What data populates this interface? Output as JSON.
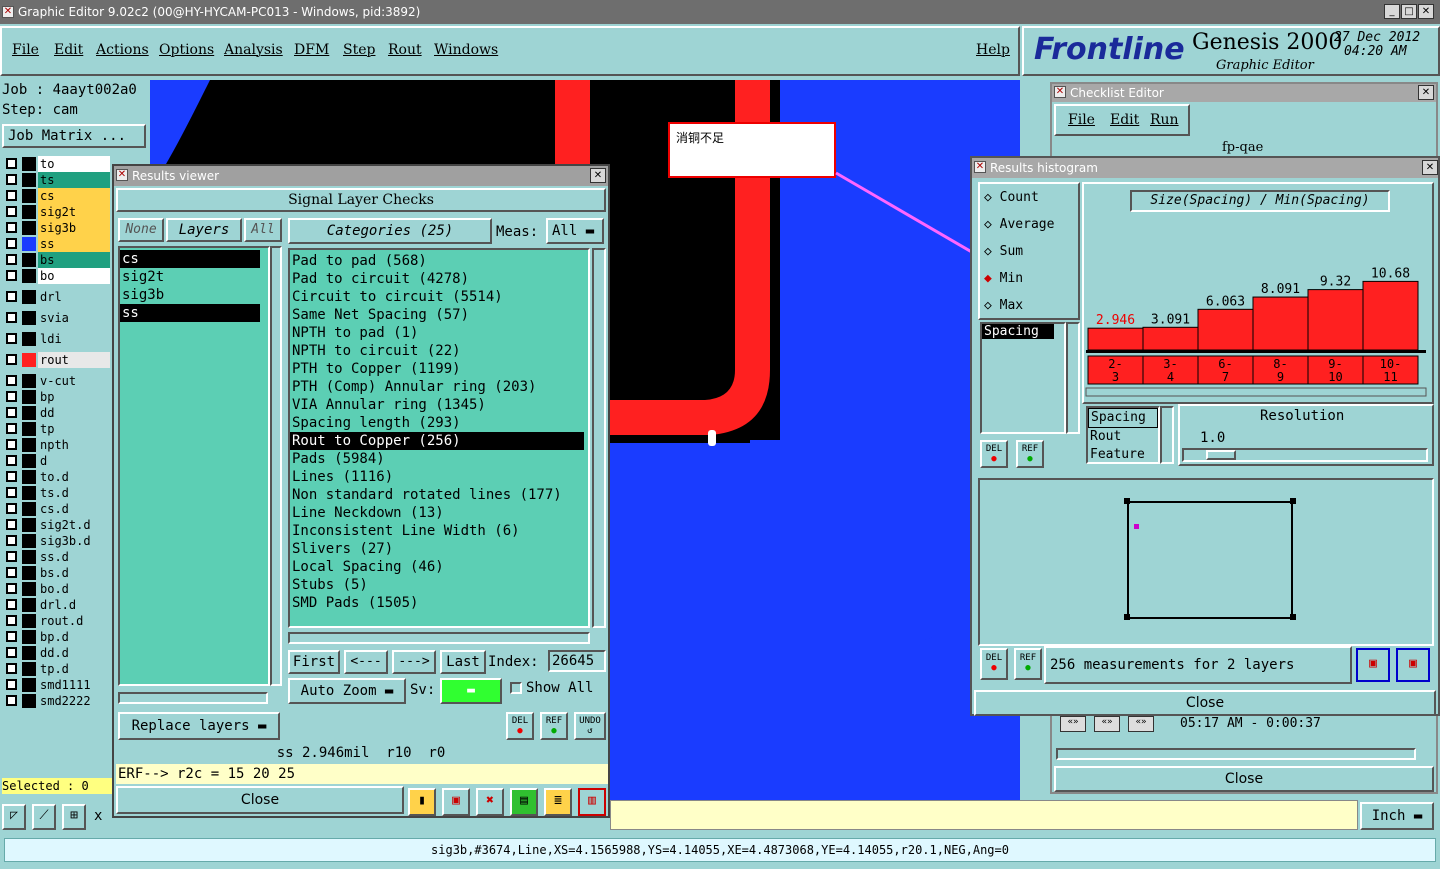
{
  "main_window": {
    "title": "Graphic Editor 9.02c2 (00@HY-HYCAM-PC013 - Windows, pid:3892)",
    "menu": [
      "File",
      "Edit",
      "Actions",
      "Options",
      "Analysis",
      "DFM",
      "Step",
      "Rout",
      "Windows"
    ],
    "help": "Help",
    "brand": "Frontline",
    "product": "Genesis 2000",
    "subtitle": "Graphic Editor",
    "date": "27 Dec 2012",
    "time": "04:20 AM"
  },
  "job_panel": {
    "job": "Job : 4aayt002a0",
    "step": "Step: cam",
    "job_matrix_button": "Job Matrix ...",
    "selected": "Selected : 0",
    "layers": [
      {
        "name": "to",
        "color": "#ffffff",
        "swatch": "#000000"
      },
      {
        "name": "ts",
        "color": "#20a080",
        "swatch": "#000000"
      },
      {
        "name": "cs",
        "color": "#ffd24a",
        "swatch": "#000000"
      },
      {
        "name": "sig2t",
        "color": "#ffd24a",
        "swatch": "#000000"
      },
      {
        "name": "sig3b",
        "color": "#ffd24a",
        "swatch": "#000000"
      },
      {
        "name": "ss",
        "color": "#ffd24a",
        "swatch": "#1a3cff"
      },
      {
        "name": "bs",
        "color": "#20a080",
        "swatch": "#000000"
      },
      {
        "name": "bo",
        "color": "#ffffff",
        "swatch": "#000000"
      },
      {
        "name": "drl",
        "color": "#9ed4d4",
        "swatch": "#000000"
      },
      {
        "name": "svia",
        "color": "#9ed4d4",
        "swatch": "#000000"
      },
      {
        "name": "ldi",
        "color": "#9ed4d4",
        "swatch": "#000000"
      },
      {
        "name": "rout",
        "color": "#e8e8e8",
        "swatch": "#ff2020"
      },
      {
        "name": "v-cut",
        "color": "#9ed4d4",
        "swatch": "#000000"
      },
      {
        "name": "bp",
        "color": "#9ed4d4",
        "swatch": "#000000"
      },
      {
        "name": "dd",
        "color": "#9ed4d4",
        "swatch": "#000000"
      },
      {
        "name": "tp",
        "color": "#9ed4d4",
        "swatch": "#000000"
      },
      {
        "name": "npth",
        "color": "#9ed4d4",
        "swatch": "#000000"
      },
      {
        "name": "d",
        "color": "#9ed4d4",
        "swatch": "#000000"
      },
      {
        "name": "to.d",
        "color": "#9ed4d4",
        "swatch": "#000000"
      },
      {
        "name": "ts.d",
        "color": "#9ed4d4",
        "swatch": "#000000"
      },
      {
        "name": "cs.d",
        "color": "#9ed4d4",
        "swatch": "#000000"
      },
      {
        "name": "sig2t.d",
        "color": "#9ed4d4",
        "swatch": "#000000"
      },
      {
        "name": "sig3b.d",
        "color": "#9ed4d4",
        "swatch": "#000000"
      },
      {
        "name": "ss.d",
        "color": "#9ed4d4",
        "swatch": "#000000"
      },
      {
        "name": "bs.d",
        "color": "#9ed4d4",
        "swatch": "#000000"
      },
      {
        "name": "bo.d",
        "color": "#9ed4d4",
        "swatch": "#000000"
      },
      {
        "name": "drl.d",
        "color": "#9ed4d4",
        "swatch": "#000000"
      },
      {
        "name": "rout.d",
        "color": "#9ed4d4",
        "swatch": "#000000"
      },
      {
        "name": "bp.d",
        "color": "#9ed4d4",
        "swatch": "#000000"
      },
      {
        "name": "dd.d",
        "color": "#9ed4d4",
        "swatch": "#000000"
      },
      {
        "name": "tp.d",
        "color": "#9ed4d4",
        "swatch": "#000000"
      },
      {
        "name": "smd1111",
        "color": "#9ed4d4",
        "swatch": "#000000"
      },
      {
        "name": "smd2222",
        "color": "#9ed4d4",
        "swatch": "#000000"
      }
    ]
  },
  "annotation": {
    "text": "消铜不足"
  },
  "results_viewer": {
    "title": "Results viewer",
    "header": "Signal Layer Checks",
    "none_btn": "None",
    "layers_label": "Layers",
    "all_btn": "All",
    "layers": [
      "cs",
      "sig2t",
      "sig3b",
      "ss"
    ],
    "categories_label": "Categories (25)",
    "meas_label": "Meas:",
    "meas_value": "All",
    "categories": [
      "Pad to pad (568)",
      "Pad to circuit (4278)",
      "Circuit to circuit (5514)",
      "Same Net Spacing (57)",
      "NPTH to pad (1)",
      "NPTH to circuit (22)",
      "PTH to Copper (1199)",
      "PTH (Comp) Annular ring (203)",
      "VIA Annular ring (1345)",
      "Spacing length (293)",
      "Rout to Copper (256)",
      "Pads (5984)",
      "Lines (1116)",
      "Non standard rotated lines (177)",
      "Line Neckdown (13)",
      "Inconsistent Line Width (6)",
      "Slivers (27)",
      "Local Spacing (46)",
      "Stubs (5)",
      "SMD Pads (1505)"
    ],
    "first_btn": "First",
    "prev_btn": "<---",
    "next_btn": "--->",
    "last_btn": "Last",
    "index_label": "Index:",
    "index_value": "26645",
    "auto_zoom": "Auto Zoom",
    "sv_label": "Sv:",
    "show_all": "Show All",
    "replace_layers": "Replace layers",
    "del": "DEL",
    "ref": "REF",
    "undo": "UNDO",
    "status": "ss 2.946mil  r10  r0",
    "erf": "ERF--> r2c = 15 20 25",
    "close": "Close"
  },
  "checklist_editor": {
    "title": "Checklist Editor",
    "menu": [
      "File",
      "Edit",
      "Run"
    ],
    "name": "fp-qae",
    "time_row": "05:17 AM - 0:00:37",
    "close": "Close"
  },
  "histogram": {
    "title": "Results histogram",
    "options": [
      "Count",
      "Average",
      "Sum",
      "Min",
      "Max"
    ],
    "selected_option": "Min",
    "chart_title": "Size(Spacing) / Min(Spacing)",
    "field_list": [
      "Spacing"
    ],
    "sort_list": [
      "Spacing",
      "Rout",
      "Feature"
    ],
    "resolution_label": "Resolution",
    "resolution_value": "1.0",
    "del": "DEL",
    "ref": "REF",
    "measurements": "256 measurements for 2 layers",
    "close": "Close"
  },
  "chart_data": {
    "type": "bar",
    "title": "Size(Spacing) / Min(Spacing)",
    "categories": [
      "2-3",
      "3-4",
      "6-7",
      "8-9",
      "9-10",
      "10-11"
    ],
    "values": [
      2.946,
      3.091,
      6.063,
      8.091,
      9.32,
      10.68
    ],
    "value_labels": [
      "2.946",
      "3.091",
      "6.063",
      "8.091",
      "9.32",
      "10.68"
    ],
    "category_labels": [
      [
        "2-",
        "3"
      ],
      [
        "3-",
        "4"
      ],
      [
        "6-",
        "7"
      ],
      [
        "8-",
        "9"
      ],
      [
        "9-",
        "10"
      ],
      [
        "10-",
        "11"
      ]
    ],
    "bar_color": "#ff2020"
  },
  "bottom": {
    "unit": "Inch",
    "x_label": "x",
    "status_line": "sig3b,#3674,Line,XS=4.1565988,YS=4.14055,XE=4.4873068,YE=4.14055,r20.1,NEG,Ang=0"
  }
}
